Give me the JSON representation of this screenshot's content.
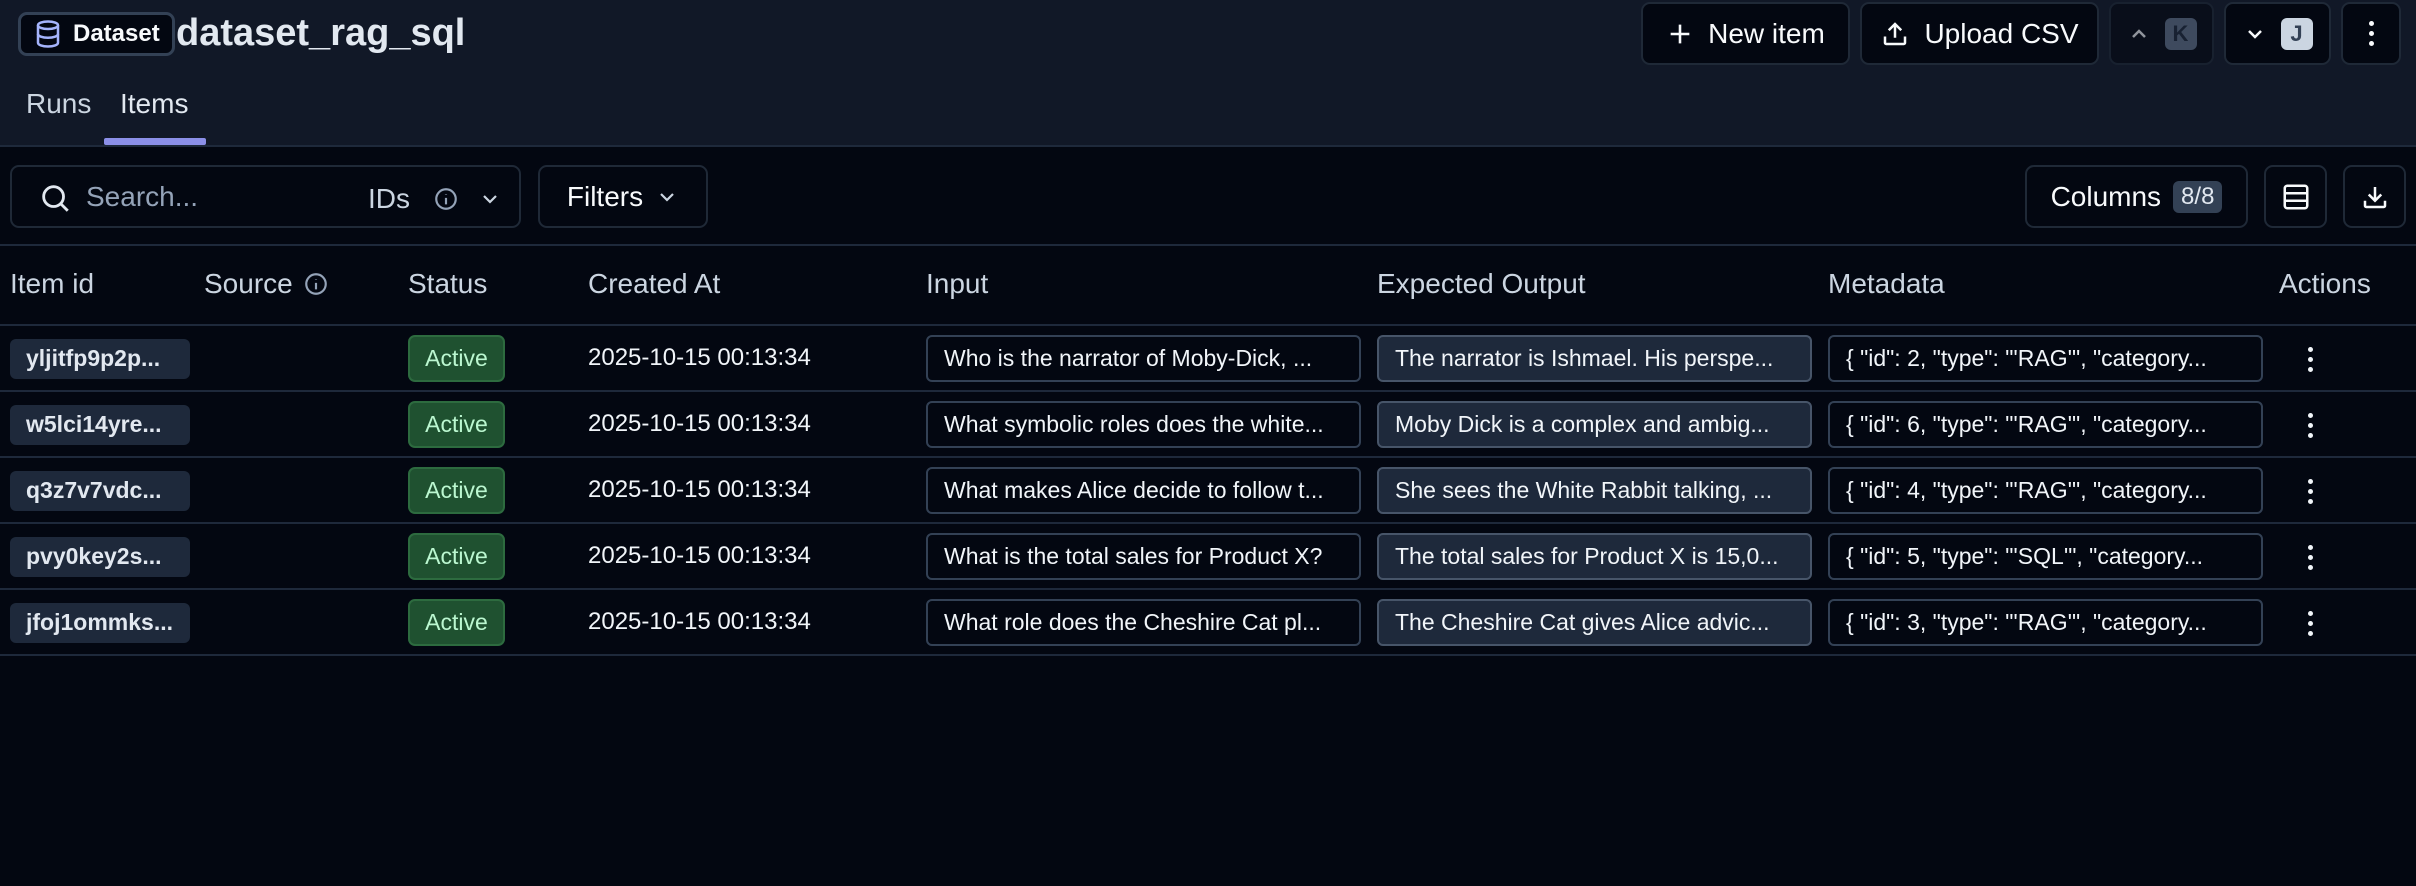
{
  "header": {
    "badge_label": "Dataset",
    "title": "dataset_rag_sql",
    "new_item_label": "New item",
    "upload_csv_label": "Upload CSV",
    "prev_key": "K",
    "next_key": "J"
  },
  "tabs": [
    {
      "label": "Runs"
    },
    {
      "label": "Items"
    }
  ],
  "toolbar": {
    "search_placeholder": "Search...",
    "search_scope": "IDs",
    "filters_label": "Filters",
    "columns_label": "Columns",
    "columns_count": "8/8"
  },
  "table": {
    "columns": [
      "Item id",
      "Source",
      "Status",
      "Created At",
      "Input",
      "Expected Output",
      "Metadata",
      "Actions"
    ],
    "rows": [
      {
        "id": "yljitfp9p2p...",
        "status": "Active",
        "created": "2025-10-15 00:13:34",
        "input": "Who is the narrator of Moby-Dick, ...",
        "expected": "The narrator is Ishmael. His perspe...",
        "metadata": "{ \"id\": 2, \"type\": \"'RAG'\", \"category..."
      },
      {
        "id": "w5lci14yre...",
        "status": "Active",
        "created": "2025-10-15 00:13:34",
        "input": "What symbolic roles does the white...",
        "expected": "Moby Dick is a complex and ambig...",
        "metadata": "{ \"id\": 6, \"type\": \"'RAG'\", \"category..."
      },
      {
        "id": "q3z7v7vdc...",
        "status": "Active",
        "created": "2025-10-15 00:13:34",
        "input": "What makes Alice decide to follow t...",
        "expected": "She sees the White Rabbit talking, ...",
        "metadata": "{ \"id\": 4, \"type\": \"'RAG'\", \"category..."
      },
      {
        "id": "pvy0key2s...",
        "status": "Active",
        "created": "2025-10-15 00:13:34",
        "input": "What is the total sales for Product X?",
        "expected": "The total sales for Product X is 15,0...",
        "metadata": "{ \"id\": 5, \"type\": \"'SQL'\", \"category..."
      },
      {
        "id": "jfoj1ommks...",
        "status": "Active",
        "created": "2025-10-15 00:13:34",
        "input": "What role does the Cheshire Cat pl...",
        "expected": "The Cheshire Cat gives Alice advic...",
        "metadata": "{ \"id\": 3, \"type\": \"'RAG'\", \"category..."
      }
    ]
  }
}
